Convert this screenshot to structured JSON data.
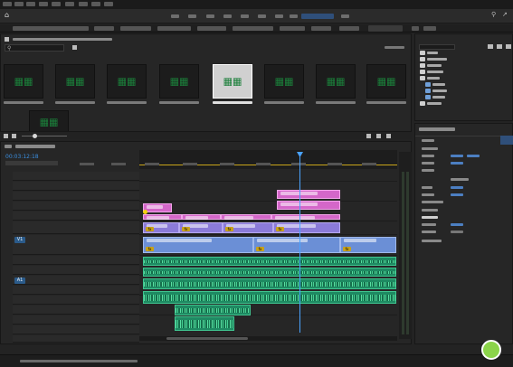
{
  "timeline": {
    "timecode": "00:03:12:18",
    "tracks": [
      {
        "tag": ""
      },
      {
        "tag": ""
      },
      {
        "tag": ""
      },
      {
        "tag": ""
      },
      {
        "tag": ""
      },
      {
        "tag": ""
      },
      {
        "tag": "V1"
      },
      {
        "tag": ""
      },
      {
        "tag": ""
      },
      {
        "tag": "A1"
      },
      {
        "tag": ""
      },
      {
        "tag": ""
      },
      {
        "tag": ""
      },
      {
        "tag": ""
      },
      {
        "tag": ""
      },
      {
        "tag": ""
      }
    ],
    "fx_badge": "fx"
  },
  "colors": {
    "app_bg": "#232323",
    "panel_bg": "#262626",
    "accent_blue": "#2b5b8a",
    "playhead": "#4aa3ff",
    "clip_pink": "#d467c9",
    "clip_violet": "#8b7bd9",
    "clip_blue": "#6b8fd6",
    "clip_green": "#1e8a62",
    "waveform": "#5ee8a8",
    "fx_badge": "#c8a21a",
    "thumb_glyph": "#1b7f3a",
    "sticker": "#8bd44a"
  },
  "icons": {
    "home": "home-icon",
    "search": "search-icon",
    "folder": "folder-icon",
    "close": "close-icon",
    "playhead": "playhead-marker-icon",
    "sticker": "green-sticker-icon"
  }
}
